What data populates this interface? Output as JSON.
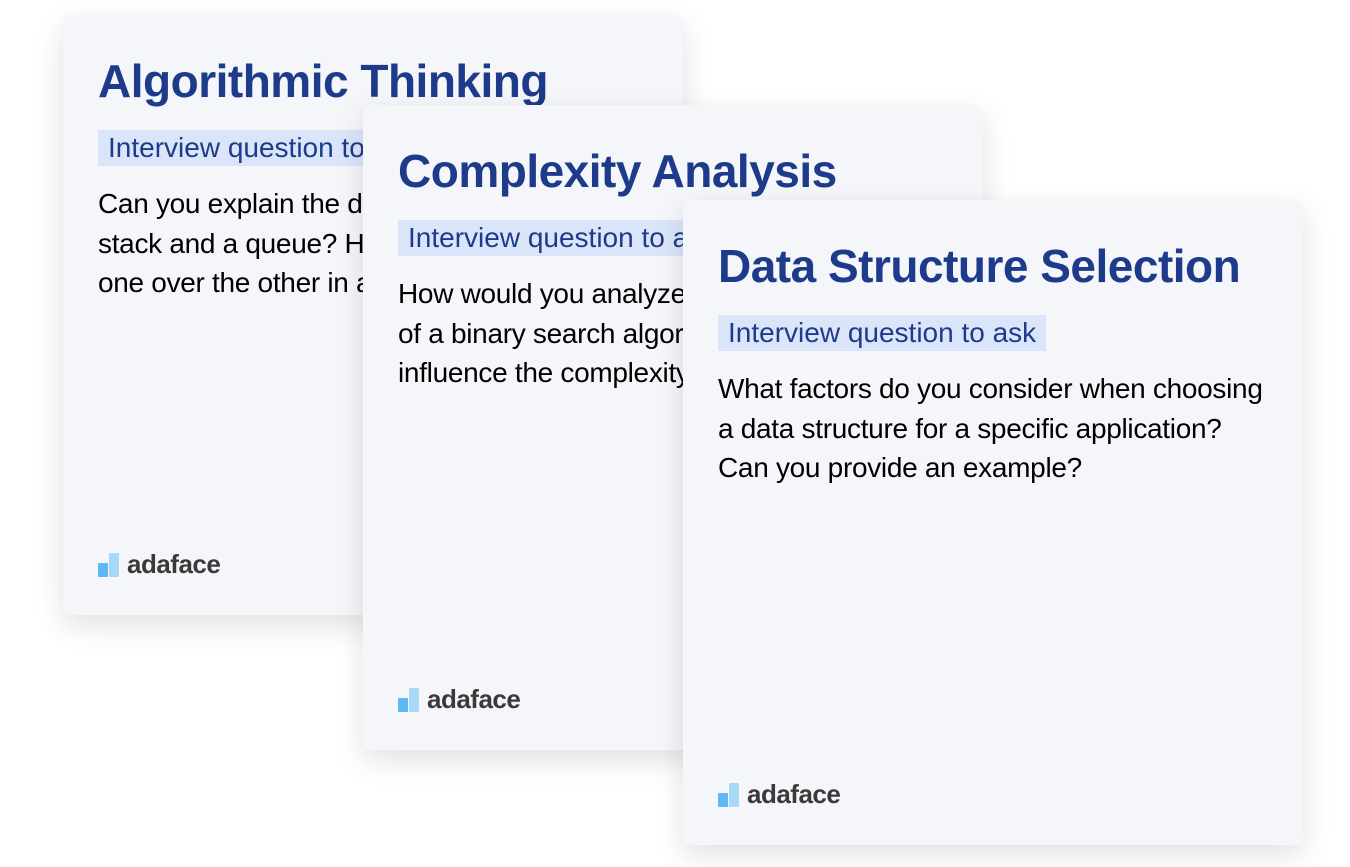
{
  "cards": [
    {
      "title": "Algorithmic Thinking",
      "subtitle": "Interview question to ask",
      "question": "Can you explain the difference between a stack and a queue? How would you choose one over the other in a specific scenario?"
    },
    {
      "title": "Complexity Analysis",
      "subtitle": "Interview question to ask",
      "question": "How would you analyze the time complexity of a binary search algorithm? What factors influence the complexity?"
    },
    {
      "title": "Data Structure Selection",
      "subtitle": "Interview question to ask",
      "question": "What factors do you consider when choosing a data structure for a specific application? Can you provide an example?"
    }
  ],
  "brand": "adaface"
}
